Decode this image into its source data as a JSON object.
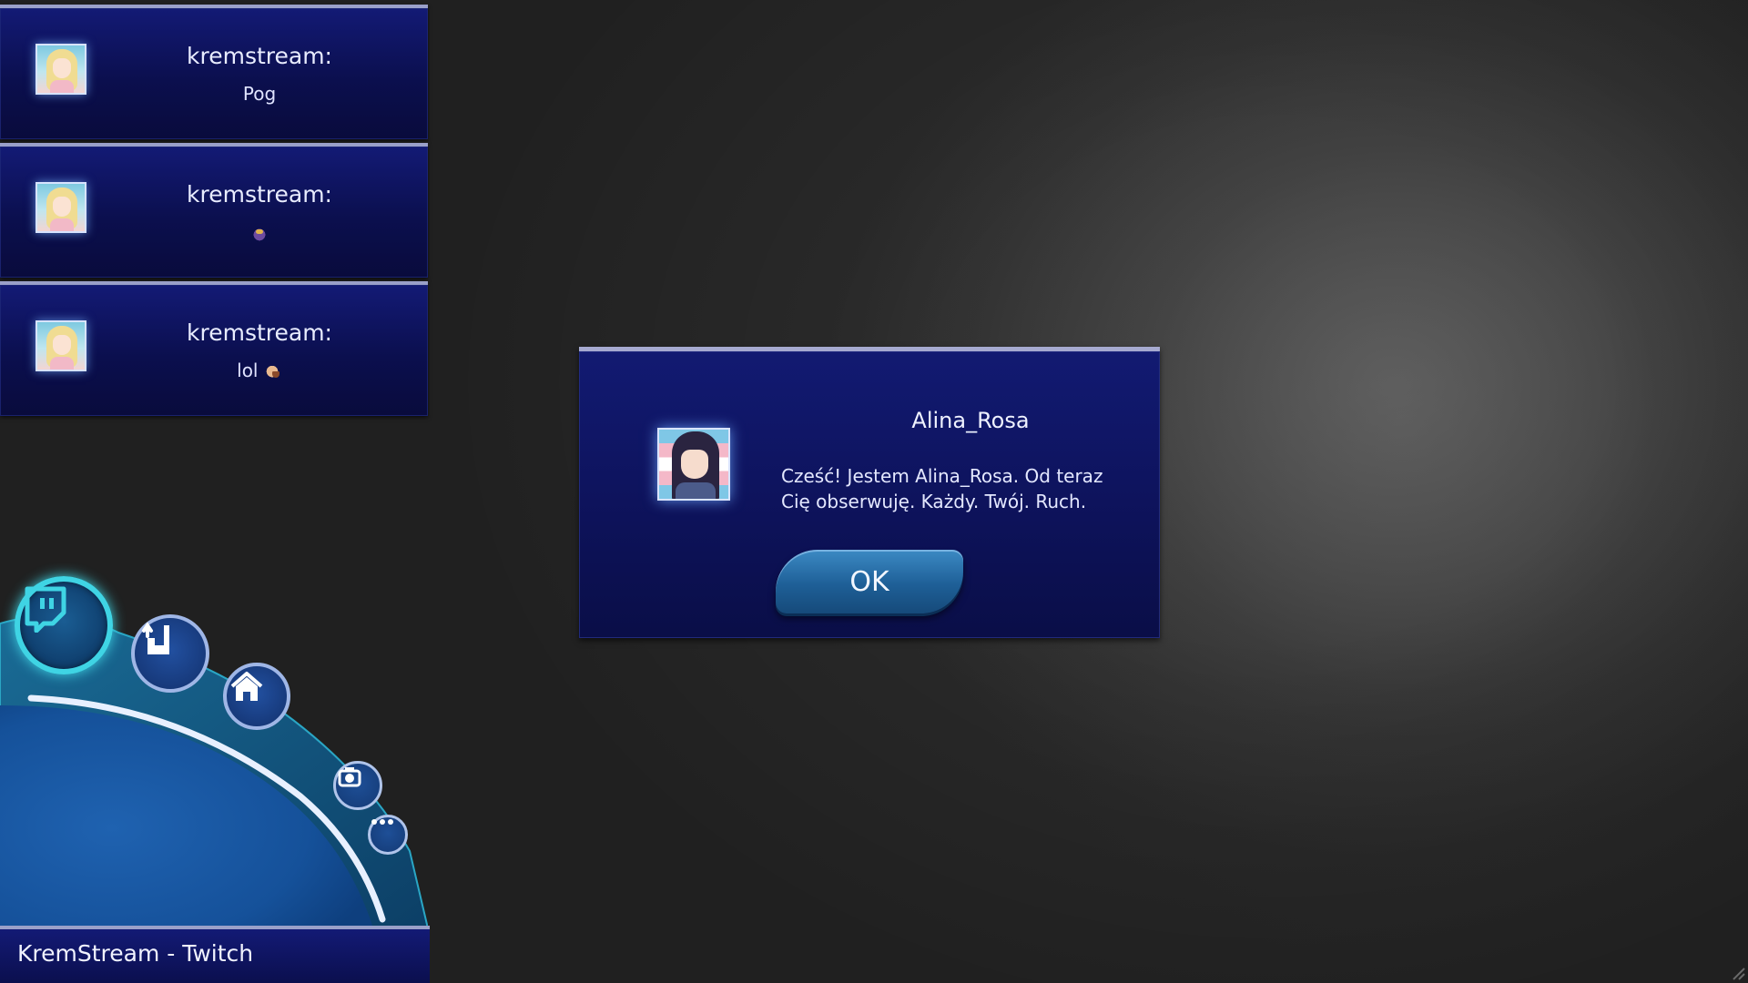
{
  "chat": {
    "messages": [
      {
        "user": "kremstream:",
        "text": "Pog",
        "emote": null
      },
      {
        "user": "kremstream:",
        "text": "",
        "emote": "bird-emote"
      },
      {
        "user": "kremstream:",
        "text": "lol",
        "emote": "laugh-emote"
      }
    ]
  },
  "dialog": {
    "name": "Alina_Rosa",
    "message": "Cześć! Jestem Alina_Rosa. Od teraz Cię obserwuję. Każdy. Twój. Ruch.",
    "ok_label": "OK"
  },
  "dock": {
    "icons": [
      "twitch-icon",
      "mod-icon",
      "home-icon",
      "camera-icon",
      "more-icon"
    ],
    "accent": "#3fd4e4"
  },
  "taskbar": {
    "title": "KremStream - Twitch"
  },
  "colors": {
    "panel": "#0d1259",
    "panel_border": "#a6aad0",
    "background": "#2d2d2d"
  }
}
